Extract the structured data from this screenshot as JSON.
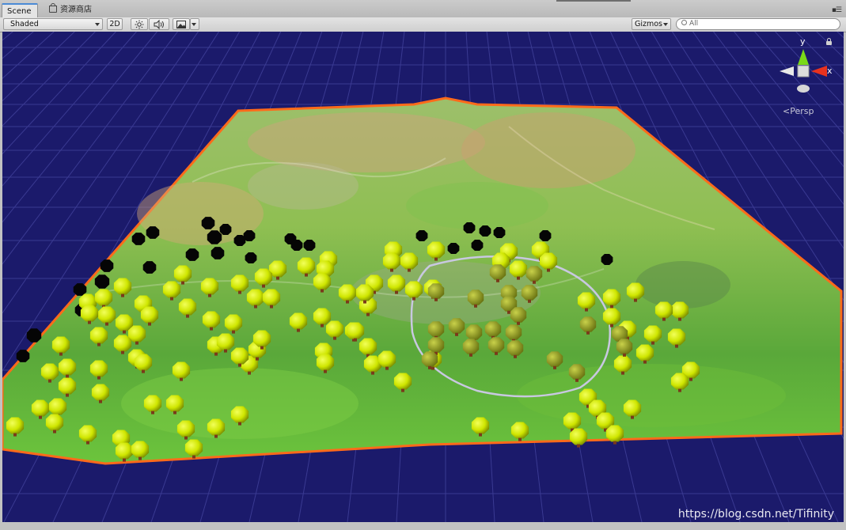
{
  "tabs": {
    "scene_label": "Scene",
    "store_label": "资源商店"
  },
  "toolbar": {
    "shading_mode": "Shaded",
    "mode_2d_label": "2D",
    "lighting_icon": "sun-icon",
    "audio_icon": "speaker-icon",
    "effects_icon": "image-icon",
    "gizmos_label": "Gizmos",
    "search_placeholder": "All"
  },
  "gizmo": {
    "y_label": "y",
    "x_label": "x",
    "projection_label": "Persp"
  },
  "watermark": "https://blog.csdn.net/Tifinity",
  "colors": {
    "viewport_background": "#1b1a6b",
    "terrain_outline": "#ff6a1a",
    "tree_foliage": "#d4f000",
    "brush_circle": "#c8c8e0",
    "axis_x": "#e8321e",
    "axis_y": "#7ad818"
  }
}
